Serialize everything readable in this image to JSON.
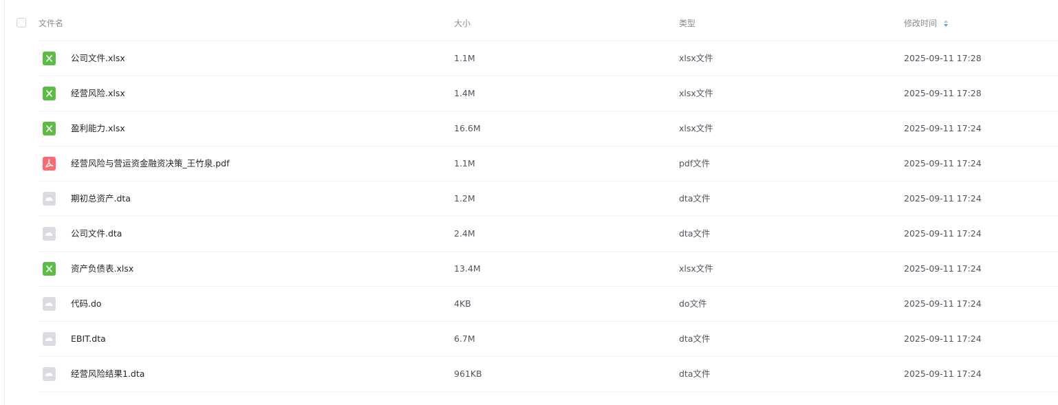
{
  "header": {
    "col_name": "文件名",
    "col_size": "大小",
    "col_type": "类型",
    "col_time": "修改时间",
    "sort_color": "#409eff"
  },
  "colors": {
    "xlsx_icon": "#5dbb46",
    "pdf_icon": "#fa6a72",
    "generic_icon": "#d9dbe0"
  },
  "files": [
    {
      "name": "公司文件.xlsx",
      "size": "1.1M",
      "type": "xlsx文件",
      "time": "2025-09-11 17:28",
      "icon": "excel-file-icon"
    },
    {
      "name": "经营风险.xlsx",
      "size": "1.4M",
      "type": "xlsx文件",
      "time": "2025-09-11 17:28",
      "icon": "excel-file-icon"
    },
    {
      "name": "盈利能力.xlsx",
      "size": "16.6M",
      "type": "xlsx文件",
      "time": "2025-09-11 17:24",
      "icon": "excel-file-icon"
    },
    {
      "name": "经营风险与营运资金融资决策_王竹泉.pdf",
      "size": "1.1M",
      "type": "pdf文件",
      "time": "2025-09-11 17:24",
      "icon": "pdf-file-icon"
    },
    {
      "name": "期初总资产.dta",
      "size": "1.2M",
      "type": "dta文件",
      "time": "2025-09-11 17:24",
      "icon": "generic-file-icon"
    },
    {
      "name": "公司文件.dta",
      "size": "2.4M",
      "type": "dta文件",
      "time": "2025-09-11 17:24",
      "icon": "generic-file-icon"
    },
    {
      "name": "资产负债表.xlsx",
      "size": "13.4M",
      "type": "xlsx文件",
      "time": "2025-09-11 17:24",
      "icon": "excel-file-icon"
    },
    {
      "name": "代码.do",
      "size": "4KB",
      "type": "do文件",
      "time": "2025-09-11 17:24",
      "icon": "generic-file-icon"
    },
    {
      "name": "EBIT.dta",
      "size": "6.7M",
      "type": "dta文件",
      "time": "2025-09-11 17:24",
      "icon": "generic-file-icon"
    },
    {
      "name": "经营风险结果1.dta",
      "size": "961KB",
      "type": "dta文件",
      "time": "2025-09-11 17:24",
      "icon": "generic-file-icon"
    }
  ]
}
